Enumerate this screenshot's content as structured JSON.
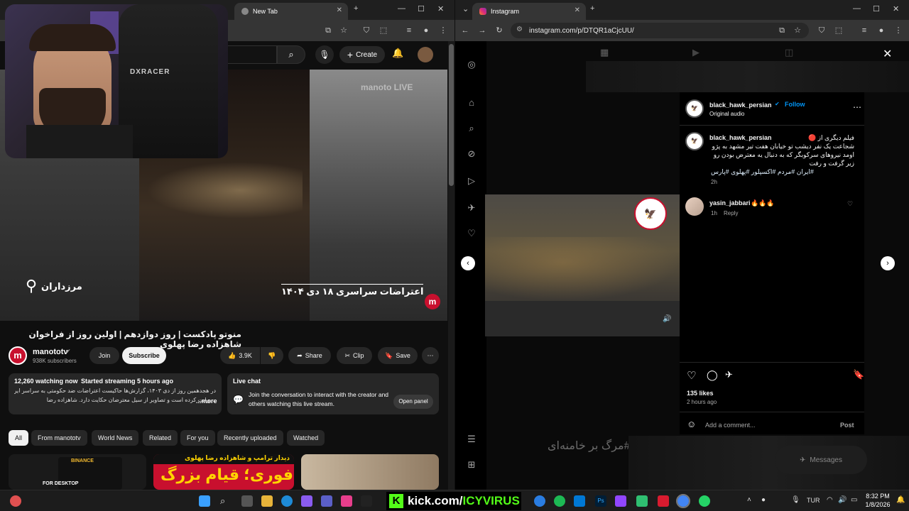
{
  "left_browser": {
    "tab_new": "New Tab",
    "youtube": {
      "create_label": "Create",
      "video_title": "منوتو پادکست | روز دوازدهم | اولین روز از فراخوان شاهزاده رضا پهلوی",
      "overlay_location": "مرزداران",
      "overlay_caption": "اعتراضات سراسری ۱۸ دی ۱۴۰۴",
      "watermark": "manoto LIVE",
      "channel_name": "manototv",
      "subscribers": "938K subscribers",
      "join_label": "Join",
      "subscribe_label": "Subscribe",
      "likes": "3.9K",
      "share_label": "Share",
      "clip_label": "Clip",
      "save_label": "Save",
      "watching": "12,260 watching now",
      "started": "Started streaming 5 hours ago",
      "desc_line1": "در هجدهمین روز از دی ۱۴۰۳، گزارش‌ها حاکیست اعتراضات ضد حکومتی به سراسر ایران",
      "desc_line2": "...برایت کرده است و تصاویر از سیل معترضان حکایت دارد. شاهزاده رضا پهلوی",
      "more_label": "...more",
      "livechat_title": "Live chat",
      "livechat_msg": "Join the conversation to interact with the creator and others watching this live stream.",
      "open_panel": "Open panel",
      "chips": [
        "All",
        "From manototv",
        "World News",
        "Related",
        "For you",
        "Recently uploaded",
        "Watched"
      ],
      "card2_text": "فوری؛ قیام بزرگ",
      "card2_head": "دیدار ترامپ و شاهزاده رضا پهلوی",
      "card1_text": "FOR DESKTOP",
      "card1_badge": "BINANCE"
    },
    "webcam_brand": "DXRACER"
  },
  "right_browser": {
    "tab_title": "Instagram",
    "url": "instagram.com/p/DTQR1aCjcUU/",
    "post": {
      "username": "black_hawk_persian",
      "follow_label": "Follow",
      "audio": "Original audio",
      "caption_user": "black_hawk_persian",
      "caption_line1": "فیلم دیگری از 🔴",
      "caption_line2": "شجاعت یک نفر دیشب تو خیابان هفت تیر مشهد به پژو",
      "caption_line3": "اومد نیروهای سرکوبگر که به دنبال یه معترض بودن رو",
      "caption_line4": "زیر گرفت و رفت",
      "hashtags": "#ایران #مردم #اکسپلور #پهلوی #پارس",
      "caption_time": "2h",
      "commenter": "yasin_jabbari",
      "comment_text": "🔥🔥🔥",
      "comment_time": "1h",
      "reply_label": "Reply",
      "likes": "135 likes",
      "posted": "2 hours ago",
      "add_comment_placeholder": "Add a comment...",
      "post_label": "Post"
    },
    "bg_text": "#مرگ بر خامنه‌ای",
    "messages_label": "Messages"
  },
  "taskbar": {
    "kick_text": "kick.com/",
    "kick_user": "ICYVIRUS",
    "lang": "TUR",
    "time": "8:32 PM",
    "date": "1/8/2026"
  },
  "colors": {
    "yt_bg": "#0f0f0f",
    "ig_blue": "#0095f6",
    "manoto_red": "#c8102e",
    "kick_green": "#53fc18"
  }
}
